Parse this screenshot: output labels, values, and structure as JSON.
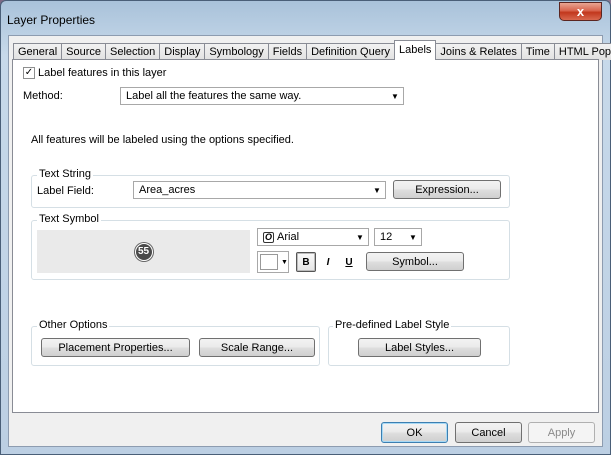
{
  "window": {
    "title": "Layer Properties",
    "close_glyph": "x"
  },
  "tabs": [
    {
      "label": "General"
    },
    {
      "label": "Source"
    },
    {
      "label": "Selection"
    },
    {
      "label": "Display"
    },
    {
      "label": "Symbology"
    },
    {
      "label": "Fields"
    },
    {
      "label": "Definition Query"
    },
    {
      "label": "Labels",
      "active": true
    },
    {
      "label": "Joins & Relates"
    },
    {
      "label": "Time"
    },
    {
      "label": "HTML Popup"
    }
  ],
  "labels_tab": {
    "label_features_checkbox": {
      "label": "Label features in this layer",
      "checked": true,
      "check_glyph": "✓"
    },
    "method": {
      "label": "Method:",
      "value": "Label all the features the same way."
    },
    "info_text": "All features will be labeled using the options specified.",
    "text_string": {
      "group_title": "Text String",
      "label_field_label": "Label Field:",
      "label_field_value": "Area_acres",
      "expression_button": "Expression..."
    },
    "text_symbol": {
      "group_title": "Text Symbol",
      "preview_badge": "55",
      "font_icon_glyph": "O",
      "font_name": "Arial",
      "font_size": "12",
      "bold_label": "B",
      "italic_label": "I",
      "underline_label": "U",
      "symbol_button": "Symbol...",
      "color_value": "#ffffff"
    },
    "other_options": {
      "group_title": "Other Options",
      "placement_button": "Placement Properties...",
      "scale_range_button": "Scale Range..."
    },
    "predefined": {
      "group_title": "Pre-defined Label Style",
      "label_styles_button": "Label Styles..."
    }
  },
  "footer": {
    "ok": "OK",
    "cancel": "Cancel",
    "apply": "Apply"
  },
  "colors": {
    "accent_border": "#3c7fb1",
    "close_red": "#c2371d"
  }
}
